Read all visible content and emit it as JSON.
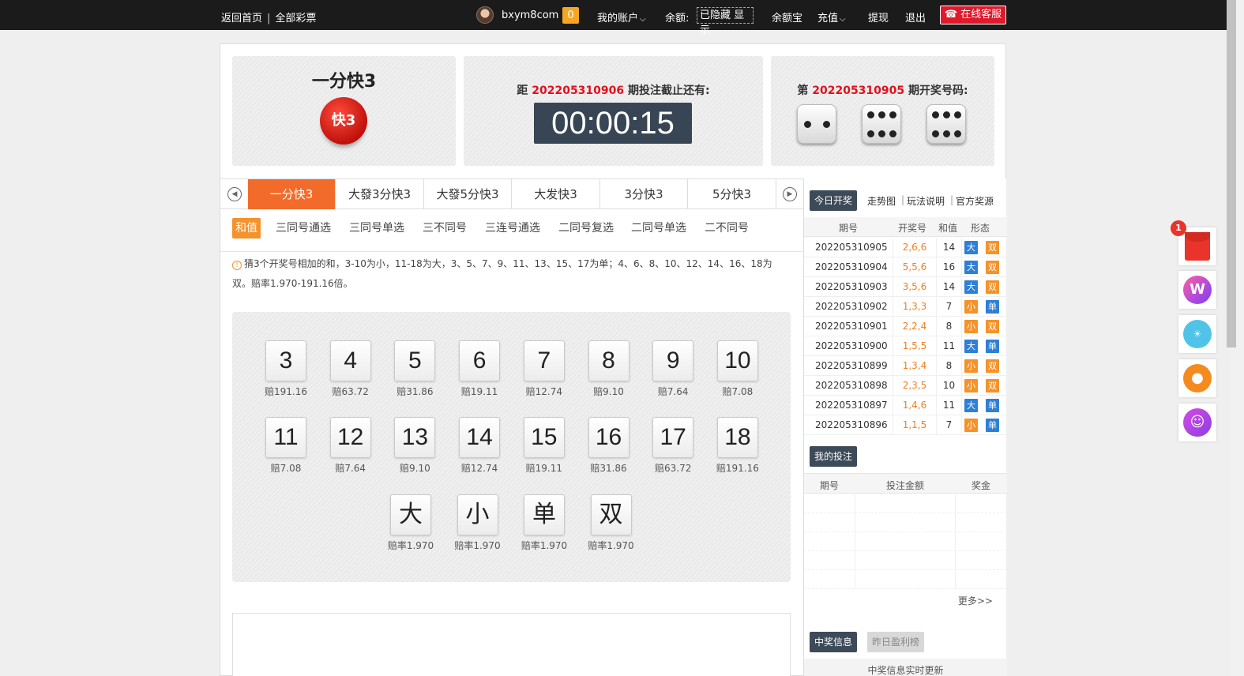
{
  "topbar": {
    "home": "返回首页",
    "separator": "|",
    "all_lottery": "全部彩票",
    "username": "bxym8com",
    "badge": "0",
    "my_account": "我的账户",
    "balance_label": "余额:",
    "balance_state": "已隐藏 显示",
    "yuebao": "余额宝",
    "recharge": "充值",
    "withdraw": "提现",
    "logout": "退出",
    "kefu": "在线客服"
  },
  "game": {
    "title": "一分快3",
    "logo_text": "快3",
    "deadline_prefix": "距",
    "deadline_issue": "202205310906",
    "deadline_suffix": "期投注截止还有:",
    "timer": "00:00:15",
    "draw_prefix": "第",
    "draw_issue": "202205310905",
    "draw_suffix": "期开奖号码:",
    "dice": [
      2,
      6,
      6
    ]
  },
  "game_tabs": [
    "一分快3",
    "大發3分快3",
    "大發5分快3",
    "大发快3",
    "3分快3",
    "5分快3"
  ],
  "sub_tabs": [
    "和值",
    "三同号通选",
    "三同号单选",
    "三不同号",
    "三连号通选",
    "二同号复选",
    "二同号单选",
    "二不同号"
  ],
  "tip": "猜3个开奖号相加的和，3-10为小，11-18为大，3、5、7、9、11、13、15、17为单；4、6、8、10、12、14、16、18为双。赔率1.970-191.16倍。",
  "sums": [
    {
      "n": "3",
      "odds": "赔191.16"
    },
    {
      "n": "4",
      "odds": "赔63.72"
    },
    {
      "n": "5",
      "odds": "赔31.86"
    },
    {
      "n": "6",
      "odds": "赔19.11"
    },
    {
      "n": "7",
      "odds": "赔12.74"
    },
    {
      "n": "8",
      "odds": "赔9.10"
    },
    {
      "n": "9",
      "odds": "赔7.64"
    },
    {
      "n": "10",
      "odds": "赔7.08"
    },
    {
      "n": "11",
      "odds": "赔7.08"
    },
    {
      "n": "12",
      "odds": "赔7.64"
    },
    {
      "n": "13",
      "odds": "赔9.10"
    },
    {
      "n": "14",
      "odds": "赔12.74"
    },
    {
      "n": "15",
      "odds": "赔19.11"
    },
    {
      "n": "16",
      "odds": "赔31.86"
    },
    {
      "n": "17",
      "odds": "赔63.72"
    },
    {
      "n": "18",
      "odds": "赔191.16"
    }
  ],
  "bsoe": [
    {
      "n": "大",
      "odds": "赔率1.970"
    },
    {
      "n": "小",
      "odds": "赔率1.970"
    },
    {
      "n": "单",
      "odds": "赔率1.970"
    },
    {
      "n": "双",
      "odds": "赔率1.970"
    }
  ],
  "right": {
    "tab_today": "今日开奖",
    "tab_trend": "走势图",
    "tab_rules": "玩法说明",
    "tab_official": "官方奖源",
    "link_sep": "|",
    "headers": [
      "期号",
      "开奖号",
      "和值",
      "形态"
    ],
    "rows": [
      {
        "issue": "202205310905",
        "nums": "2,6,6",
        "sum": "14",
        "size": "大",
        "parity": "双"
      },
      {
        "issue": "202205310904",
        "nums": "5,5,6",
        "sum": "16",
        "size": "大",
        "parity": "双"
      },
      {
        "issue": "202205310903",
        "nums": "3,5,6",
        "sum": "14",
        "size": "大",
        "parity": "双"
      },
      {
        "issue": "202205310902",
        "nums": "1,3,3",
        "sum": "7",
        "size": "小",
        "parity": "单"
      },
      {
        "issue": "202205310901",
        "nums": "2,2,4",
        "sum": "8",
        "size": "小",
        "parity": "双"
      },
      {
        "issue": "202205310900",
        "nums": "1,5,5",
        "sum": "11",
        "size": "大",
        "parity": "单"
      },
      {
        "issue": "202205310899",
        "nums": "1,3,4",
        "sum": "8",
        "size": "小",
        "parity": "双"
      },
      {
        "issue": "202205310898",
        "nums": "2,3,5",
        "sum": "10",
        "size": "小",
        "parity": "双"
      },
      {
        "issue": "202205310897",
        "nums": "1,4,6",
        "sum": "11",
        "size": "大",
        "parity": "单"
      },
      {
        "issue": "202205310896",
        "nums": "1,1,5",
        "sum": "7",
        "size": "小",
        "parity": "单"
      }
    ],
    "my_bets": "我的投注",
    "bet_headers": [
      "期号",
      "投注金额",
      "奖金"
    ],
    "more": "更多>>",
    "win_info": "中奖信息",
    "yesterday": "昨日盈利榜",
    "win_strip": "中奖信息实时更新"
  },
  "float": {
    "notif": "1",
    "icons": [
      "red-envelope-icon",
      "w-app-icon",
      "hot-icon",
      "group-service-icon",
      "chat-bot-icon"
    ]
  },
  "colors": {
    "accent": "#f36b2a",
    "red": "#e0111e",
    "timer_bg": "#384554",
    "big_tag": "#2e7fd6",
    "small_tag": "#f5922a"
  }
}
